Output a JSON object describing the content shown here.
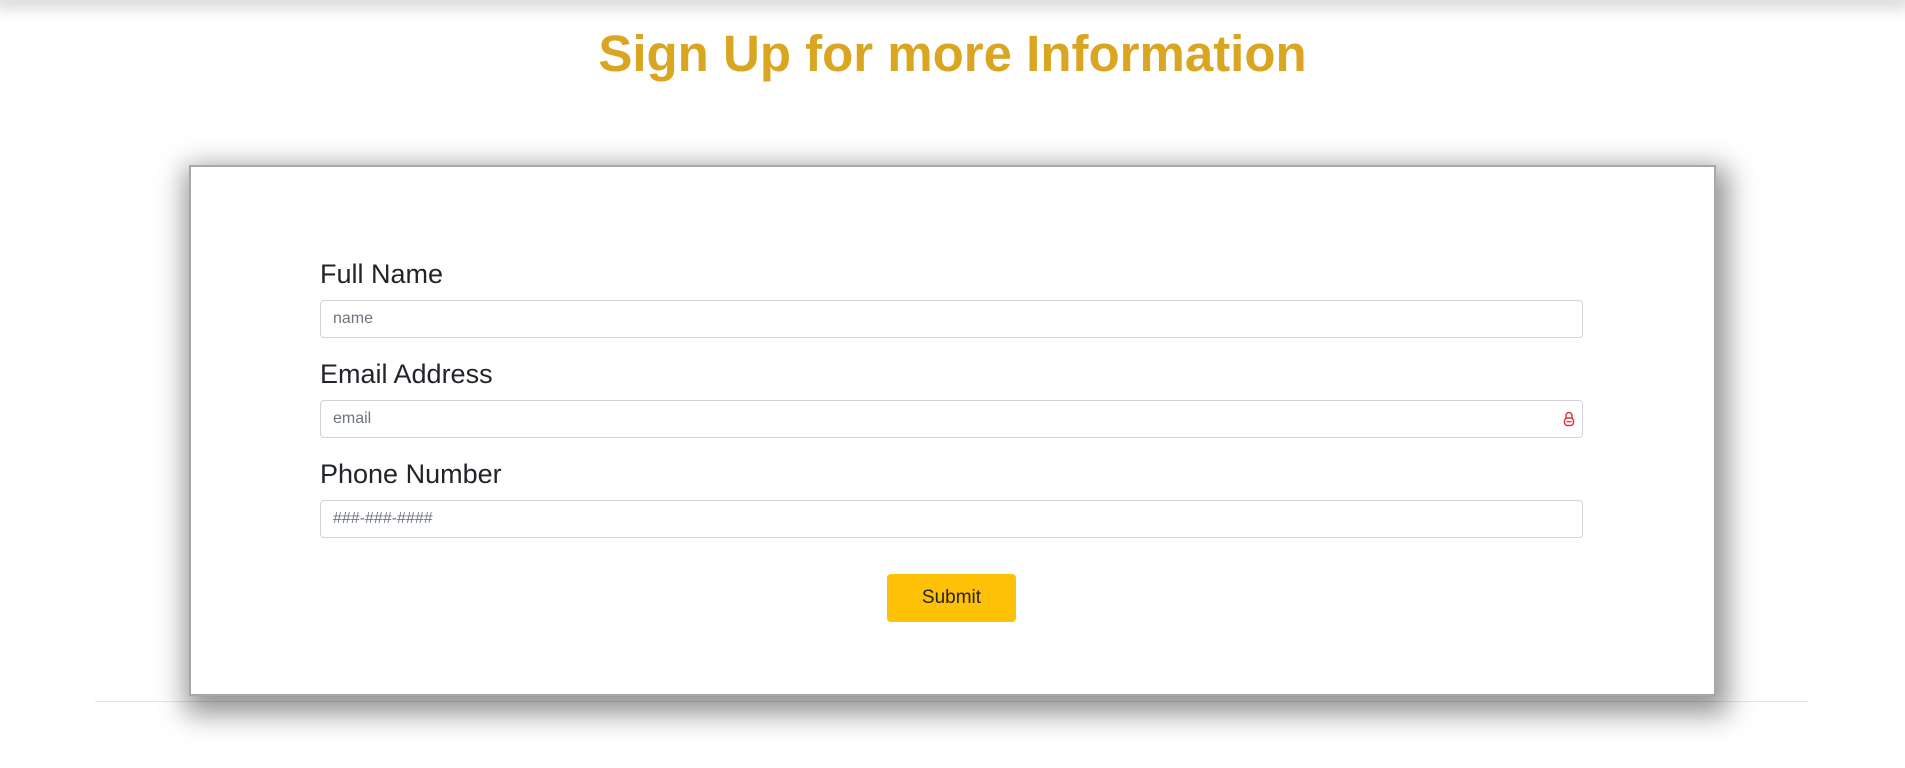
{
  "page": {
    "title": "Sign Up for more Information"
  },
  "form": {
    "fields": [
      {
        "label": "Full Name",
        "placeholder": "name",
        "value": ""
      },
      {
        "label": "Email Address",
        "placeholder": "email",
        "value": "",
        "trailing_icon": "password-manager-lock-icon"
      },
      {
        "label": "Phone Number",
        "placeholder": "###-###-####",
        "value": ""
      }
    ],
    "submit_label": "Submit"
  },
  "colors": {
    "title": "#DAA520",
    "submit_button": "#FFC107",
    "lock_icon": "#dc3545"
  }
}
